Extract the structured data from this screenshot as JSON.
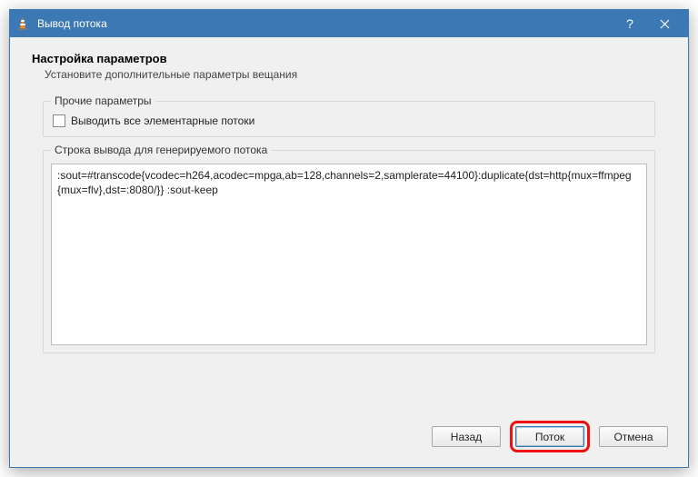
{
  "titlebar": {
    "title": "Вывод потока"
  },
  "page": {
    "heading": "Настройка параметров",
    "subheading": "Установите дополнительные параметры вещания"
  },
  "misc_group": {
    "legend": "Прочие параметры",
    "checkbox_label": "Выводить все элементарные потоки",
    "checked": false
  },
  "output_group": {
    "legend": "Строка вывода для генерируемого потока",
    "value": ":sout=#transcode{vcodec=h264,acodec=mpga,ab=128,channels=2,samplerate=44100}:duplicate{dst=http{mux=ffmpeg{mux=flv},dst=:8080/}} :sout-keep"
  },
  "buttons": {
    "back": "Назад",
    "stream": "Поток",
    "cancel": "Отмена"
  }
}
